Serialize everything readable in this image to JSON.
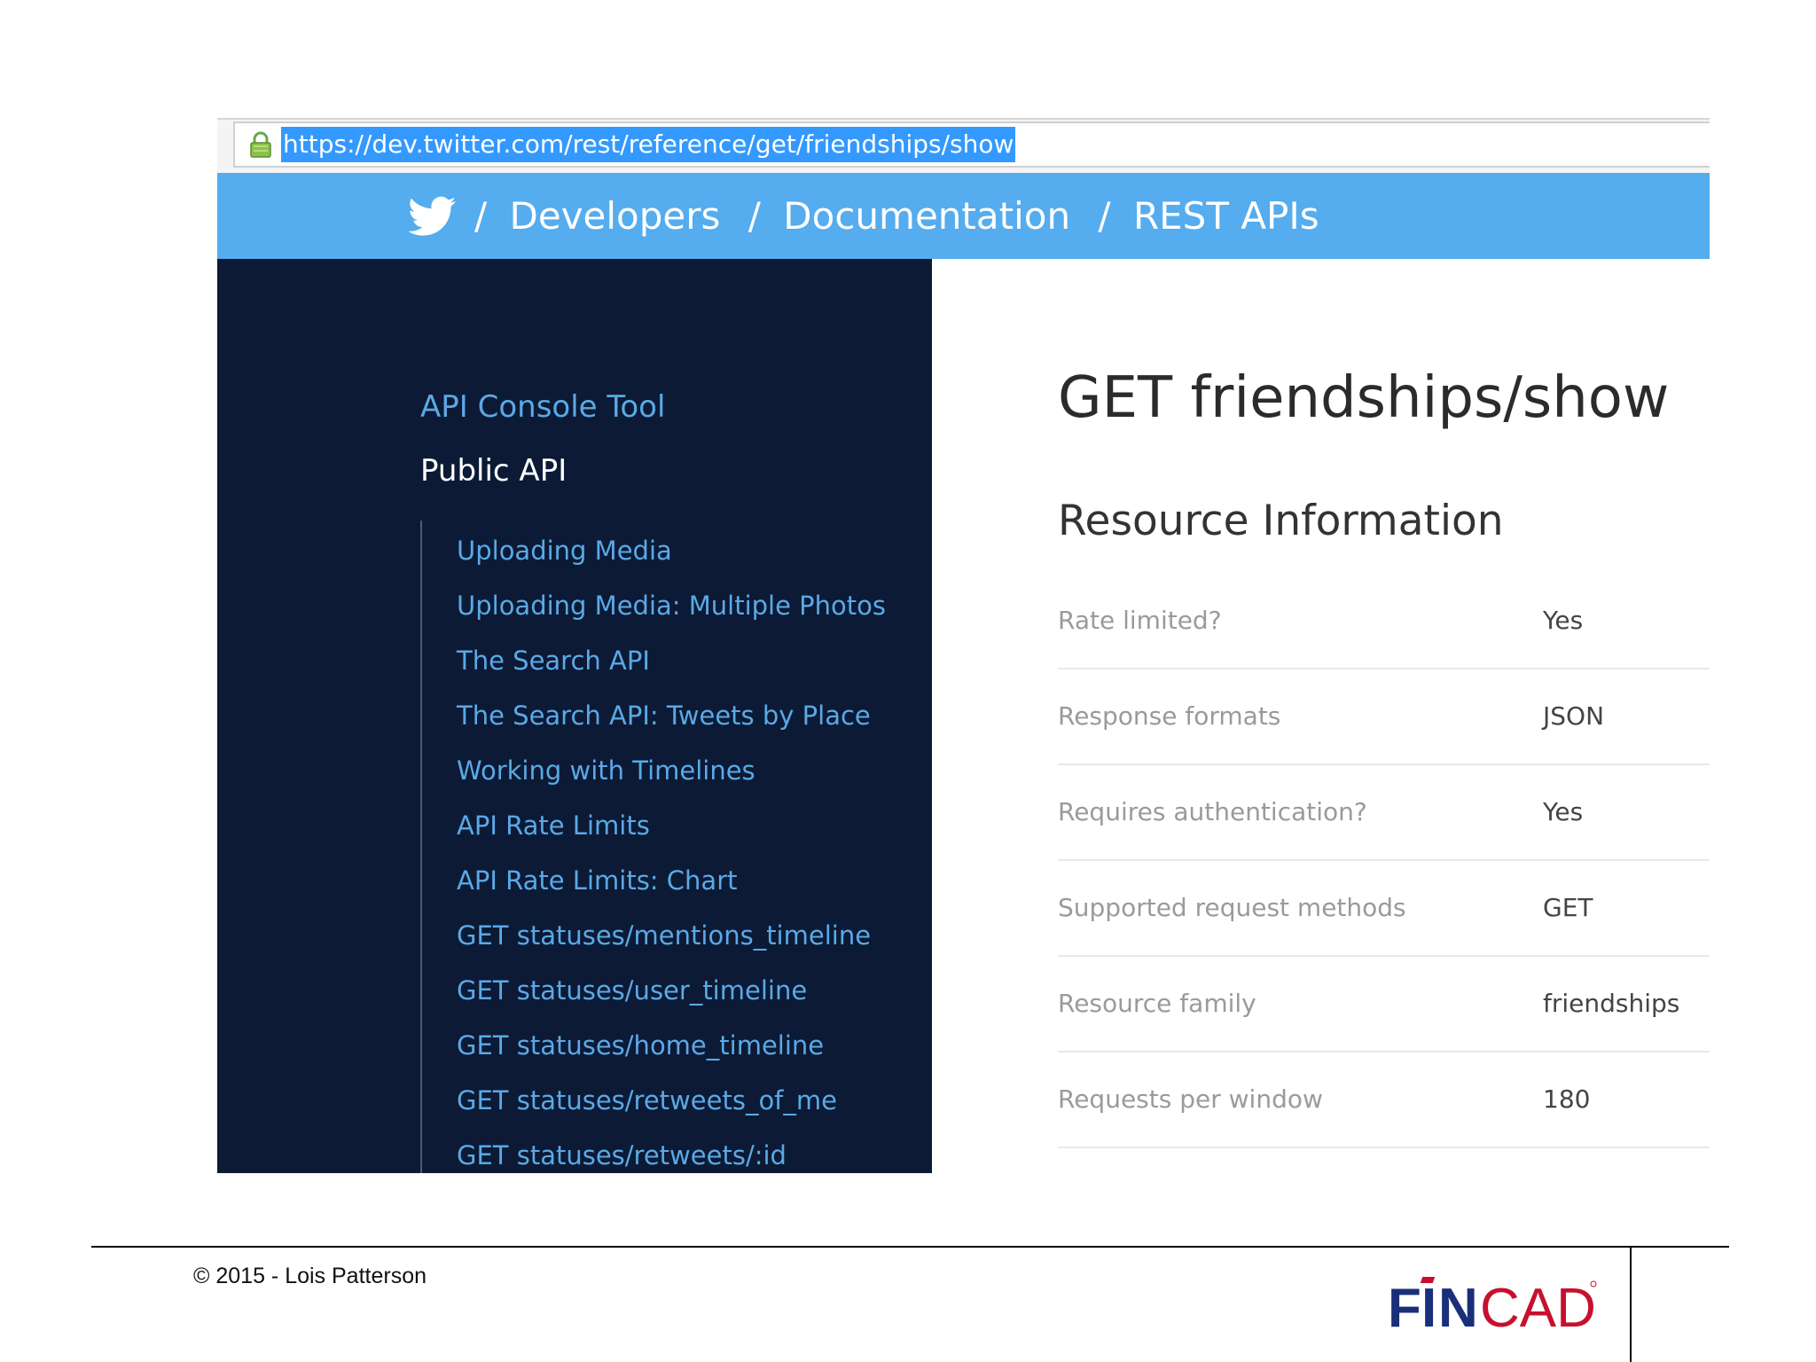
{
  "browser": {
    "url": "https://dev.twitter.com/rest/reference/get/friendships/show"
  },
  "nav": {
    "icons": {
      "bird": "twitter-bird-icon"
    },
    "separator": "/",
    "crumbs": [
      "Developers",
      "Documentation",
      "REST APIs"
    ],
    "bar_color": "#55acee"
  },
  "sidebar": {
    "top_link": "API Console Tool",
    "section": "Public API",
    "items": [
      "Uploading Media",
      "Uploading Media: Multiple Photos",
      "The Search API",
      "The Search API: Tweets by Place",
      "Working with Timelines",
      "API Rate Limits",
      "API Rate Limits: Chart",
      "GET statuses/mentions_timeline",
      "GET statuses/user_timeline",
      "GET statuses/home_timeline",
      "GET statuses/retweets_of_me",
      "GET statuses/retweets/:id"
    ],
    "bg_color": "#0c1a35",
    "link_color": "#5aa9e6"
  },
  "main": {
    "title": "GET friendships/show",
    "subtitle": "Resource Information",
    "rows": [
      {
        "label": "Rate limited?",
        "value": "Yes"
      },
      {
        "label": "Response formats",
        "value": "JSON"
      },
      {
        "label": "Requires authentication?",
        "value": "Yes"
      },
      {
        "label": "Supported request methods",
        "value": "GET"
      },
      {
        "label": "Resource family",
        "value": "friendships"
      },
      {
        "label": "Requests per window",
        "value": "180"
      }
    ]
  },
  "footer": {
    "copyright": "© 2015 - Lois Patterson",
    "logo_text": "FINCAD",
    "logo_colors": {
      "fin": "#1a2f7a",
      "cad": "#c8102e"
    }
  }
}
